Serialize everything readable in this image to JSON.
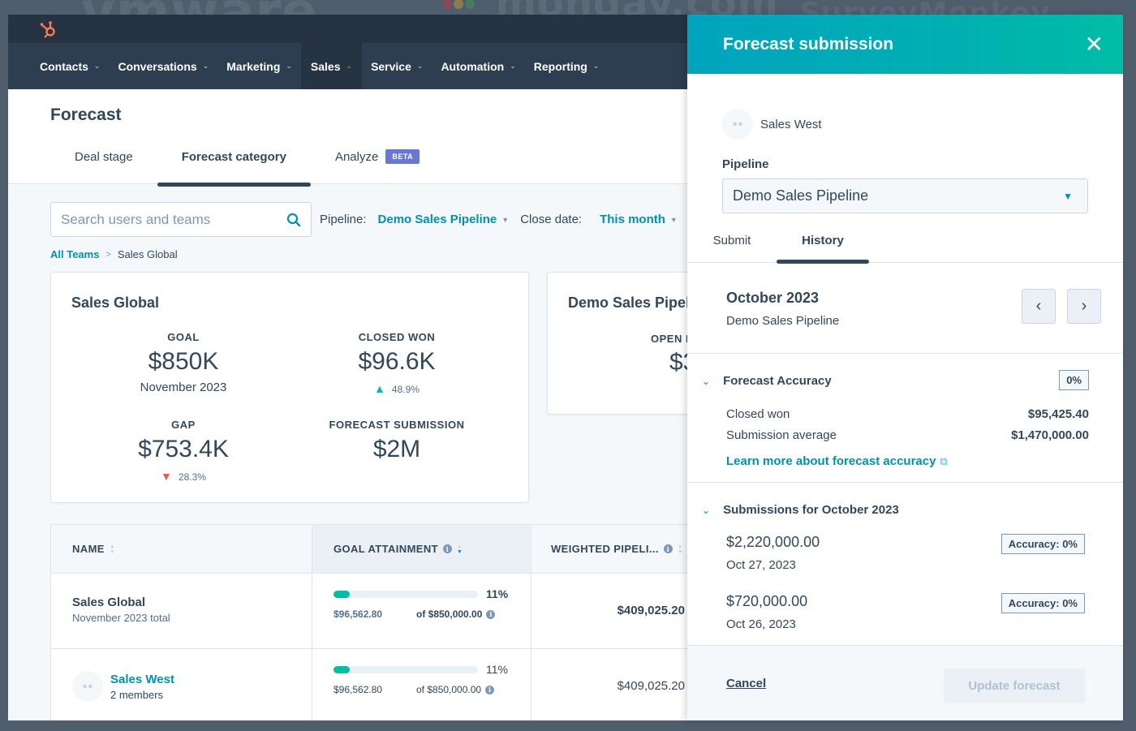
{
  "background_logos": [
    "vmware",
    "monday.com",
    "SurveyMonkey"
  ],
  "nav": {
    "items": [
      {
        "label": "Contacts",
        "active": false
      },
      {
        "label": "Conversations",
        "active": false
      },
      {
        "label": "Marketing",
        "active": false
      },
      {
        "label": "Sales",
        "active": true
      },
      {
        "label": "Service",
        "active": false
      },
      {
        "label": "Automation",
        "active": false
      },
      {
        "label": "Reporting",
        "active": false
      }
    ]
  },
  "page": {
    "title": "Forecast",
    "tabs": [
      {
        "label": "Deal stage",
        "active": false
      },
      {
        "label": "Forecast category",
        "active": true
      },
      {
        "label": "Analyze",
        "active": false,
        "badge": "BETA"
      }
    ],
    "search": {
      "placeholder": "Search users and teams",
      "value": ""
    },
    "filters": {
      "pipeline_label": "Pipeline:",
      "pipeline_value": "Demo Sales Pipeline",
      "close_date_label": "Close date:",
      "close_date_value": "This month"
    },
    "breadcrumb": {
      "root": "All Teams",
      "separator": ">",
      "current": "Sales Global"
    }
  },
  "summary_card": {
    "title": "Sales Global",
    "goal": {
      "label": "GOAL",
      "value": "$850K",
      "sub": "November 2023"
    },
    "closed_won": {
      "label": "CLOSED WON",
      "value": "$96.6K",
      "delta": "48.9%",
      "direction": "up"
    },
    "gap": {
      "label": "GAP",
      "value": "$753.4K",
      "delta": "28.3%",
      "direction": "down"
    },
    "forecast_submission": {
      "label": "FORECAST SUBMISSION",
      "value": "$2M"
    }
  },
  "second_card": {
    "title": "Demo Sales Pipel",
    "label": "OPEN F",
    "value": "$3"
  },
  "table": {
    "columns": [
      "NAME",
      "GOAL ATTAINMENT",
      "WEIGHTED PIPELI..."
    ],
    "rows": [
      {
        "name": "Sales Global",
        "sub": "November 2023 total",
        "attainment_pct": 11,
        "attainment_label": "11%",
        "closed": "$96,562.80",
        "goal": "of $850,000.00",
        "weighted": "$409,025.20"
      },
      {
        "name": "Sales West",
        "sub": "2 members",
        "attainment_pct": 11,
        "attainment_label": "11%",
        "closed": "$96,562.80",
        "goal": "of $850,000.00",
        "weighted": "$409,025.20"
      }
    ]
  },
  "panel": {
    "title": "Forecast submission",
    "team": "Sales West",
    "pipeline_label": "Pipeline",
    "pipeline_value": "Demo Sales Pipeline",
    "tabs": [
      {
        "label": "Submit",
        "active": false
      },
      {
        "label": "History",
        "active": true
      }
    ],
    "period": {
      "title": "October 2023",
      "subtitle": "Demo Sales Pipeline"
    },
    "accuracy": {
      "title": "Forecast Accuracy",
      "badge": "0%",
      "rows": [
        {
          "label": "Closed won",
          "value": "$95,425.40"
        },
        {
          "label": "Submission average",
          "value": "$1,470,000.00"
        }
      ],
      "learn_more": "Learn more about forecast accuracy"
    },
    "submissions": {
      "title": "Submissions for October 2023",
      "items": [
        {
          "amount": "$2,220,000.00",
          "date": "Oct 27, 2023",
          "accuracy": "Accuracy: 0%"
        },
        {
          "amount": "$720,000.00",
          "date": "Oct 26, 2023",
          "accuracy": "Accuracy: 0%"
        }
      ]
    },
    "footer": {
      "cancel": "Cancel",
      "update": "Update forecast"
    }
  },
  "colors": {
    "accent": "#0091ae",
    "nav_bg": "#2d3e50",
    "topbar_bg": "#253342",
    "success": "#00bda5",
    "danger": "#f2545b",
    "brand_orange": "#ff7a59",
    "beta": "#6a78d1"
  }
}
